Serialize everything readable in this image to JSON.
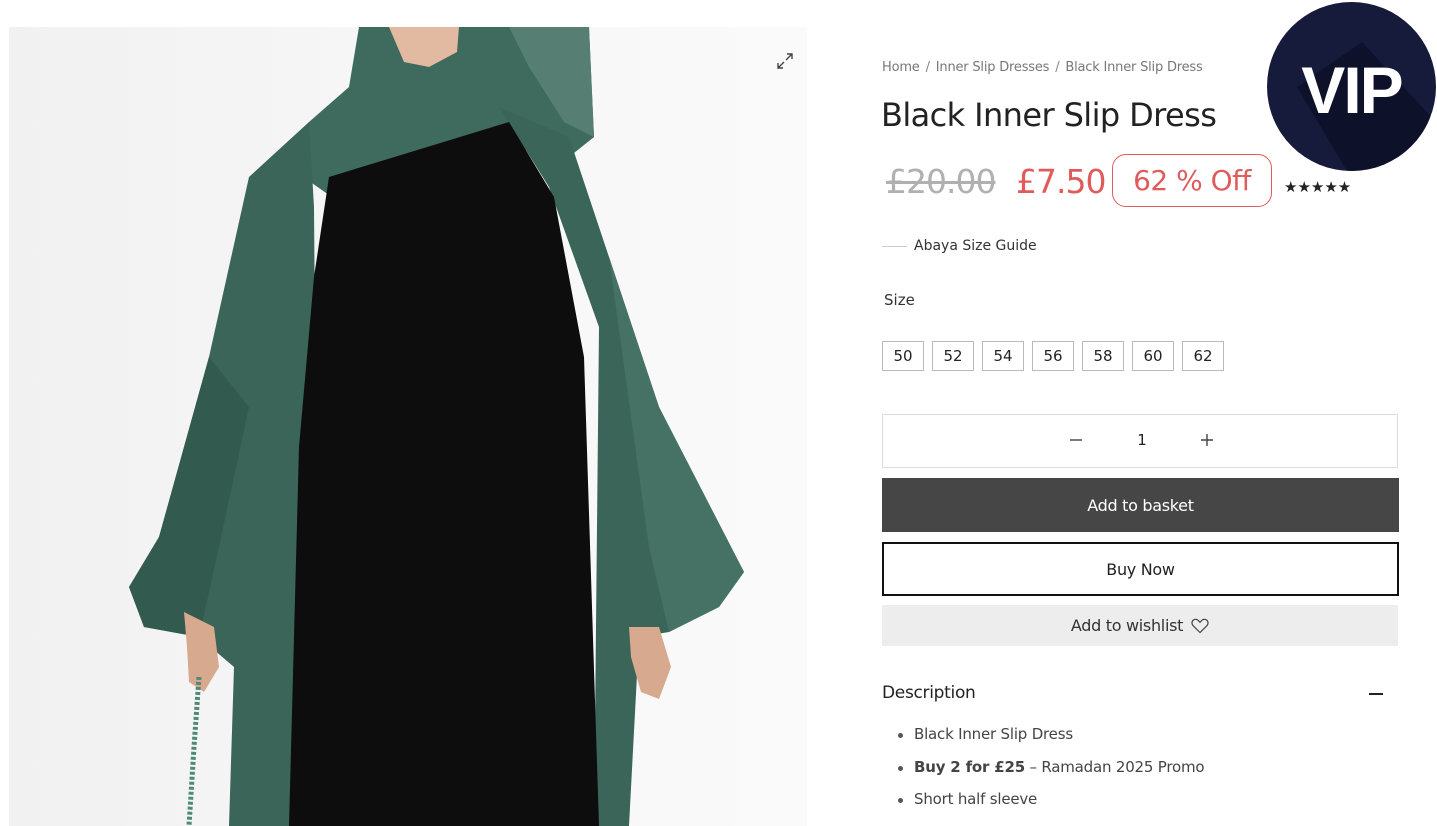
{
  "breadcrumb": {
    "home": "Home",
    "category": "Inner Slip Dresses",
    "current": "Black Inner Slip Dress",
    "separator": "/"
  },
  "product": {
    "title": "Black Inner Slip Dress",
    "old_price": "£20.00",
    "new_price": "£7.50",
    "discount": "62 % Off",
    "rating_stars": "★★★★★",
    "rating_value": 5
  },
  "badge": {
    "text": "VIP"
  },
  "size_guide": {
    "label": "Abaya Size Guide"
  },
  "size": {
    "label": "Size",
    "options": [
      "50",
      "52",
      "54",
      "56",
      "58",
      "60",
      "62"
    ]
  },
  "quantity": {
    "value": "1"
  },
  "actions": {
    "add_to_basket": "Add to basket",
    "buy_now": "Buy Now",
    "add_to_wishlist": "Add to wishlist"
  },
  "description": {
    "heading": "Description",
    "items": [
      {
        "text": "Black Inner Slip Dress"
      },
      {
        "bold": "Buy 2 for £25",
        "text": " – Ramadan 2025 Promo"
      },
      {
        "text": "Short half sleeve"
      }
    ]
  },
  "colors": {
    "sale": "#e05c5c",
    "old_price": "#b0b0b0",
    "basket_button": "#464646",
    "vip_badge": "#161b3c",
    "abaya_green": "#3e6b5f",
    "dress_black": "#0d0d0d"
  },
  "icons": {
    "expand": "expand-icon",
    "minus": "minus-icon",
    "plus": "plus-icon",
    "heart": "heart-icon",
    "collapse": "minus-collapse-icon"
  }
}
